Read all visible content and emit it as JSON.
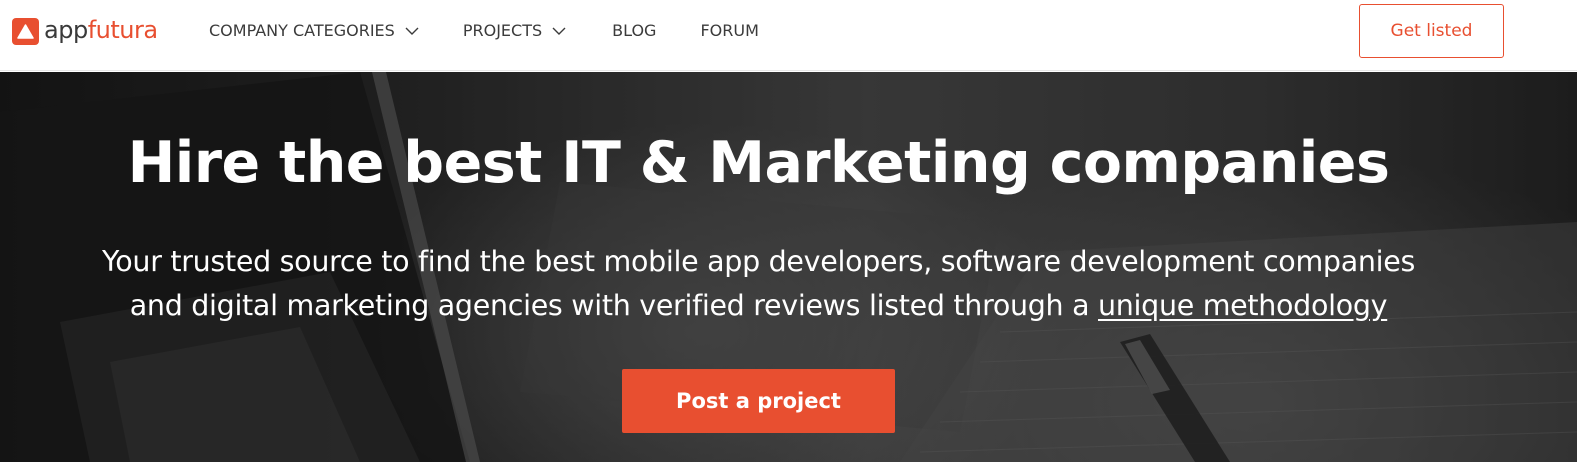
{
  "brand": {
    "logo_part_1": "app",
    "logo_part_2": "futura",
    "accent_color": "#e84f30"
  },
  "nav": {
    "items": [
      {
        "label": "COMPANY CATEGORIES",
        "has_dropdown": true
      },
      {
        "label": "PROJECTS",
        "has_dropdown": true
      },
      {
        "label": "BLOG",
        "has_dropdown": false
      },
      {
        "label": "FORUM",
        "has_dropdown": false
      }
    ],
    "cta_label": "Get listed"
  },
  "hero": {
    "title": "Hire the best IT & Marketing companies",
    "subtitle_line_1": "Your trusted source to find the best mobile app developers, software development companies",
    "subtitle_line_2_prefix": "and digital marketing agencies with verified reviews listed through a ",
    "subtitle_link": "unique methodology",
    "cta_label": "Post a project"
  },
  "icons": {
    "logo_mark": "warning-triangle-icon",
    "dropdown": "chevron-down-icon"
  }
}
